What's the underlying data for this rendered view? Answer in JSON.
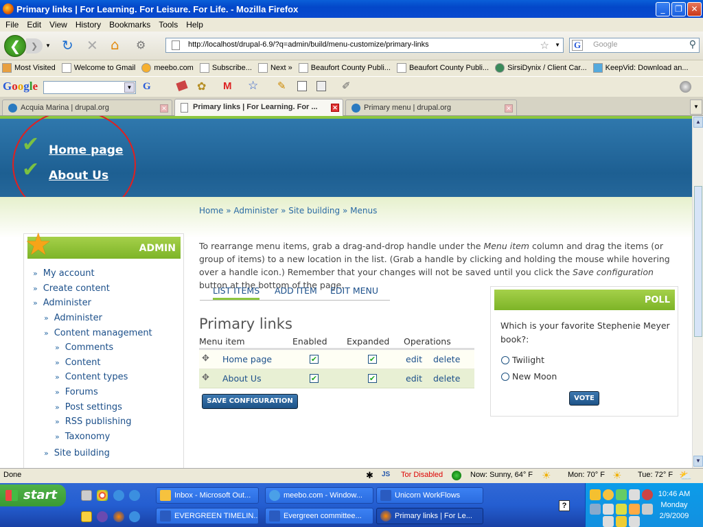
{
  "window": {
    "title": "Primary links | For Learning. For Leisure. For Life. - Mozilla Firefox"
  },
  "menubar": [
    "File",
    "Edit",
    "View",
    "History",
    "Bookmarks",
    "Tools",
    "Help"
  ],
  "navbar": {
    "url": "http://localhost/drupal-6.9/?q=admin/build/menu-customize/primary-links",
    "search_placeholder": "Google"
  },
  "bookmarks": [
    "Most Visited",
    "Welcome to Gmail",
    "meebo.com",
    "Subscribe...",
    "Next »",
    "Beaufort County Publi...",
    "Beaufort County Publi...",
    "SirsiDynix / Client Car...",
    "KeepVid: Download an..."
  ],
  "google_toolbar": {
    "logo": "Google"
  },
  "tabs": [
    {
      "label": "Acquia Marina | drupal.org"
    },
    {
      "label": "Primary links | For Learning. For ..."
    },
    {
      "label": "Primary menu | drupal.org"
    }
  ],
  "header_links": [
    "Home page",
    "About Us"
  ],
  "breadcrumb": "Home » Administer » Site building » Menus",
  "sidebar": {
    "title": "ADMIN",
    "items": [
      {
        "label": "My account",
        "level": 1
      },
      {
        "label": "Create content",
        "level": 1
      },
      {
        "label": "Administer",
        "level": 1
      },
      {
        "label": "Administer",
        "level": 2
      },
      {
        "label": "Content management",
        "level": 2
      },
      {
        "label": "Comments",
        "level": 3
      },
      {
        "label": "Content",
        "level": 3
      },
      {
        "label": "Content types",
        "level": 3
      },
      {
        "label": "Forums",
        "level": 3
      },
      {
        "label": "Post settings",
        "level": 3
      },
      {
        "label": "RSS publishing",
        "level": 3
      },
      {
        "label": "Taxonomy",
        "level": 3
      },
      {
        "label": "Site building",
        "level": 2
      }
    ]
  },
  "intro": {
    "p1": "To rearrange menu items, grab a drag-and-drop handle under the ",
    "em1": "Menu item",
    "p2": " column and drag the items (or group of items) to a new location in the list. (Grab a handle by clicking and holding the mouse while hovering over a handle icon.) Remember that your changes will not be saved until you click the ",
    "em2": "Save configuration",
    "p3": " button at the bottom of the page."
  },
  "local_tabs": [
    "LIST ITEMS",
    "ADD ITEM",
    "EDIT MENU"
  ],
  "menu_title": "Primary links",
  "table": {
    "headers": [
      "Menu item",
      "Enabled",
      "Expanded",
      "Operations"
    ],
    "rows": [
      {
        "item": "Home page",
        "enabled": true,
        "expanded": true,
        "edit": "edit",
        "delete": "delete"
      },
      {
        "item": "About Us",
        "enabled": true,
        "expanded": true,
        "edit": "edit",
        "delete": "delete"
      }
    ]
  },
  "save_button": "SAVE CONFIGURATION",
  "poll": {
    "title": "POLL",
    "question": "Which is your favorite Stephenie Meyer book?:",
    "options": [
      "Twilight",
      "New Moon"
    ],
    "vote": "VOTE"
  },
  "status": {
    "left": "Done",
    "tor": "Tor Disabled",
    "now": "Now: Sunny, 64° F",
    "mon": "Mon: 70° F",
    "tue": "Tue: 72° F"
  },
  "taskbar": {
    "start": "start",
    "buttons": [
      {
        "label": "Inbox - Microsoft Out..."
      },
      {
        "label": "meebo.com - Window..."
      },
      {
        "label": "Unicorn WorkFlows"
      },
      {
        "label": "EVERGREEN TIMELIN..."
      },
      {
        "label": "Evergreen committee..."
      },
      {
        "label": "Primary links | For Le..."
      }
    ],
    "clock": {
      "time": "10:46 AM",
      "day": "Monday",
      "date": "2/9/2009"
    }
  },
  "colors": {
    "accent_green": "#8cc63f",
    "header_blue": "#1d5f92",
    "link_blue": "#1b4f8a"
  }
}
